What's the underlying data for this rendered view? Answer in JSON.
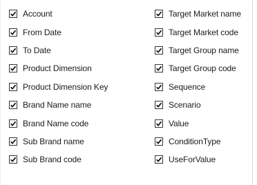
{
  "checkbox_list": {
    "left_column": [
      {
        "label": "Account",
        "checked": true
      },
      {
        "label": "From Date",
        "checked": true
      },
      {
        "label": "To Date",
        "checked": true
      },
      {
        "label": "Product Dimension",
        "checked": true
      },
      {
        "label": "Product Dimension Key",
        "checked": true
      },
      {
        "label": "Brand Name name",
        "checked": true
      },
      {
        "label": "Brand Name code",
        "checked": true
      },
      {
        "label": "Sub Brand name",
        "checked": true
      },
      {
        "label": "Sub Brand code",
        "checked": true
      }
    ],
    "right_column": [
      {
        "label": "Target Market name",
        "checked": true
      },
      {
        "label": "Target Market code",
        "checked": true
      },
      {
        "label": "Target Group name",
        "checked": true
      },
      {
        "label": "Target Group code",
        "checked": true
      },
      {
        "label": "Sequence",
        "checked": true
      },
      {
        "label": "Scenario",
        "checked": true
      },
      {
        "label": "Value",
        "checked": true
      },
      {
        "label": "ConditionType",
        "checked": true
      },
      {
        "label": "UseForValue",
        "checked": true
      }
    ]
  },
  "icons": {
    "checkmark": "checkmark-icon"
  }
}
